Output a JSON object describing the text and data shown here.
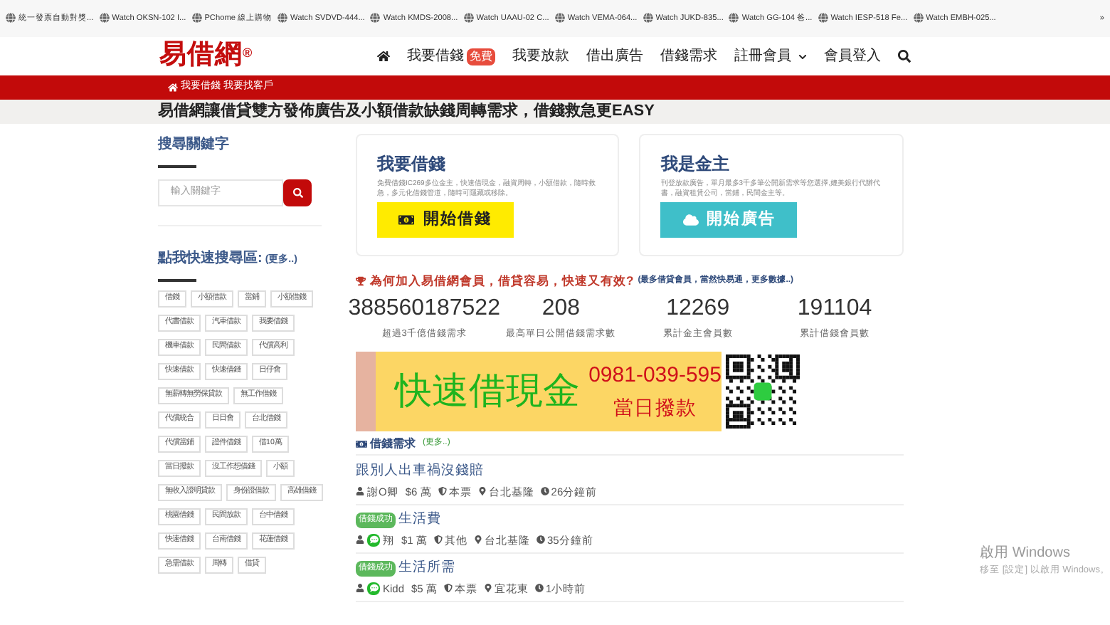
{
  "bookmarks": [
    {
      "label": "統一發票自動對獎..."
    },
    {
      "label": "Watch OKSN-102 I..."
    },
    {
      "label": "PChome 線上購物"
    },
    {
      "label": "Watch SVDVD-444..."
    },
    {
      "label": "Watch KMDS-2008..."
    },
    {
      "label": "Watch UAAU-02 C..."
    },
    {
      "label": "Watch VEMA-064..."
    },
    {
      "label": "Watch JUKD-835..."
    },
    {
      "label": "Watch GG-104 爸..."
    },
    {
      "label": "Watch IESP-518 Fe..."
    },
    {
      "label": "Watch EMBH-025..."
    }
  ],
  "bookmarks_more": "»",
  "logo": "易借網",
  "logo_mark": "®",
  "nav": [
    {
      "label": "我要借錢",
      "badge": "免費"
    },
    {
      "label": "我要放款"
    },
    {
      "label": "借出廣告"
    },
    {
      "label": "借錢需求"
    },
    {
      "label": "註冊會員",
      "dropdown": true
    },
    {
      "label": "會員登入"
    }
  ],
  "breadcrumb": [
    "我要借錢",
    "我要找客戶"
  ],
  "headline": "易借網讓借貸雙方發佈廣告及小額借款缺錢周轉需求，借錢救急更EASY",
  "sidebar": {
    "search_title": "搜尋關鍵字",
    "search_placeholder": "輸入關鍵字",
    "quick_title": "點我快速搜尋區:",
    "quick_more": "(更多..)",
    "tags": [
      "借錢",
      "小額借款",
      "當鋪",
      "小額借錢",
      "代書借款",
      "汽車借款",
      "我要借錢",
      "機車借款",
      "民間借款",
      "代償高利",
      "快速借款",
      "快速借錢",
      "日仔會",
      "無薪轉無勞保貸款",
      "無工作借錢",
      "代償統合",
      "日日會",
      "台北借錢",
      "代償當鋪",
      "證件借錢",
      "借10萬",
      "當日撥款",
      "沒工作想借錢",
      "小額",
      "無收入證明貸款",
      "身份證借款",
      "高雄借錢",
      "桃園借錢",
      "民間放款",
      "台中借錢",
      "快速借錢",
      "台南借錢",
      "花蓮借錢",
      "急需借款",
      "周轉",
      "借貸"
    ]
  },
  "cards": [
    {
      "kind": "borrow",
      "title": "我要借錢",
      "text": "免費借錢IC269多位金主，快速借現金，融資周轉，小額借款，隨時救急，多元化借錢管道，隨時可隱藏或移除。",
      "button": "開始借錢"
    },
    {
      "kind": "lend",
      "title": "我是金主",
      "text": "刊登放款廣告，單月最多3千多筆公開新需求等您選擇,媲美銀行代辦代書，融資租賃公司，當鋪，民間金主等。",
      "button": "開始廣告"
    }
  ],
  "why": {
    "title": "為何加入易借網會員，借貸容易，快速又有效?",
    "note": "(最多借貸會員，當然快易通，更多數據..)"
  },
  "stats": [
    {
      "value": "388560187522",
      "label": "超過3千億借錢需求"
    },
    {
      "value": "208",
      "label": "最高單日公開借錢需求數"
    },
    {
      "value": "12269",
      "label": "累計金主會員數"
    },
    {
      "value": "191104",
      "label": "累計借錢會員數"
    }
  ],
  "banner": {
    "headline": "快速借現金",
    "phone": "0981-039-595",
    "subline": "當日撥款"
  },
  "needs_title": "借錢需求",
  "needs_more": "(更多..)",
  "needs": [
    {
      "title": "跟別人出車禍沒錢賠",
      "success": false,
      "line": false,
      "name": "謝O卿",
      "amount": "$6 萬",
      "guarantee": "本票",
      "area": "台北基隆",
      "time": "26分鐘前"
    },
    {
      "title": "生活費",
      "success": true,
      "success_label": "借錢成功",
      "line": true,
      "name": "翔",
      "amount": "$1 萬",
      "guarantee": "其他",
      "area": "台北基隆",
      "time": "35分鐘前"
    },
    {
      "title": "生活所需",
      "success": true,
      "success_label": "借錢成功",
      "line": true,
      "name": "Kidd",
      "amount": "$5 萬",
      "guarantee": "本票",
      "area": "宜花東",
      "time": "1小時前"
    }
  ],
  "windows_notice": {
    "title": "啟用 Windows",
    "text": "移至 [設定] 以啟用 Windows。"
  }
}
